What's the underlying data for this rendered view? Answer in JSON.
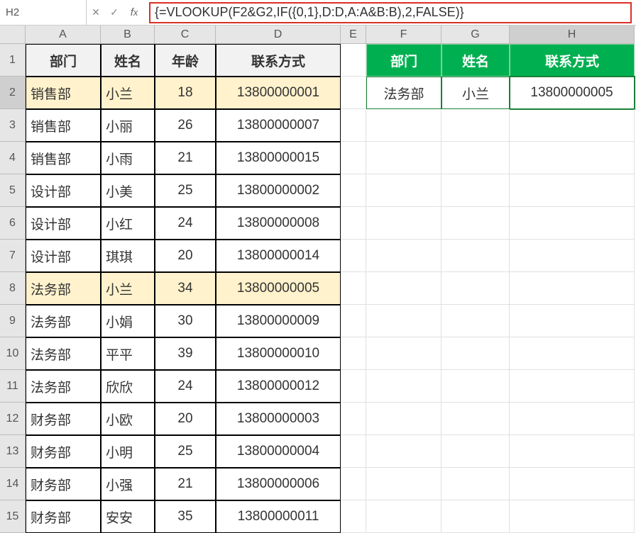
{
  "formula_bar": {
    "cell_ref": "H2",
    "formula": "{=VLOOKUP(F2&G2,IF({0,1},D:D,A:A&B:B),2,FALSE)}"
  },
  "columns": [
    "A",
    "B",
    "C",
    "D",
    "E",
    "F",
    "G",
    "H"
  ],
  "row_count": 15,
  "left_headers": {
    "A": "部门",
    "B": "姓名",
    "C": "年龄",
    "D": "联系方式"
  },
  "right_headers": {
    "F": "部门",
    "G": "姓名",
    "H": "联系方式"
  },
  "data": [
    {
      "dept": "销售部",
      "name": "小兰",
      "age": 18,
      "contact": "13800000001"
    },
    {
      "dept": "销售部",
      "name": "小丽",
      "age": 26,
      "contact": "13800000007"
    },
    {
      "dept": "销售部",
      "name": "小雨",
      "age": 21,
      "contact": "13800000015"
    },
    {
      "dept": "设计部",
      "name": "小美",
      "age": 25,
      "contact": "13800000002"
    },
    {
      "dept": "设计部",
      "name": "小红",
      "age": 24,
      "contact": "13800000008"
    },
    {
      "dept": "设计部",
      "name": "琪琪",
      "age": 20,
      "contact": "13800000014"
    },
    {
      "dept": "法务部",
      "name": "小兰",
      "age": 34,
      "contact": "13800000005"
    },
    {
      "dept": "法务部",
      "name": "小娟",
      "age": 30,
      "contact": "13800000009"
    },
    {
      "dept": "法务部",
      "name": "平平",
      "age": 39,
      "contact": "13800000010"
    },
    {
      "dept": "法务部",
      "name": "欣欣",
      "age": 24,
      "contact": "13800000012"
    },
    {
      "dept": "财务部",
      "name": "小欧",
      "age": 20,
      "contact": "13800000003"
    },
    {
      "dept": "财务部",
      "name": "小明",
      "age": 25,
      "contact": "13800000004"
    },
    {
      "dept": "财务部",
      "name": "小强",
      "age": 21,
      "contact": "13800000006"
    },
    {
      "dept": "财务部",
      "name": "安安",
      "age": 35,
      "contact": "13800000011"
    }
  ],
  "highlight_rows": [
    0,
    6
  ],
  "lookup": {
    "F": "法务部",
    "G": "小兰",
    "H": "13800000005"
  },
  "active_col": "H",
  "active_row": 2
}
